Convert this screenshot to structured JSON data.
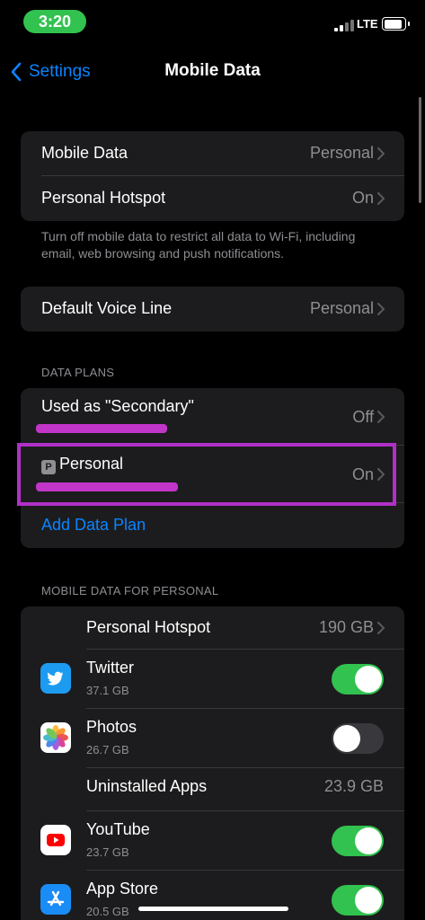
{
  "status_bar": {
    "time": "3:20",
    "network": "LTE"
  },
  "nav": {
    "back_label": "Settings",
    "title": "Mobile Data"
  },
  "main_group": {
    "rows": [
      {
        "label": "Mobile Data",
        "value": "Personal"
      },
      {
        "label": "Personal Hotspot",
        "value": "On"
      }
    ]
  },
  "main_footnote": "Turn off mobile data to restrict all data to Wi-Fi, including email, web browsing and push notifications.",
  "voice_line": {
    "label": "Default Voice Line",
    "value": "Personal"
  },
  "data_plans": {
    "header": "DATA PLANS",
    "secondary": {
      "label": "Used as \"Secondary\"",
      "value": "Off"
    },
    "personal": {
      "badge": "P",
      "label": "Personal",
      "value": "On"
    },
    "add_plan": "Add Data Plan"
  },
  "usage": {
    "header": "MOBILE DATA FOR PERSONAL",
    "hotspot": {
      "label": "Personal Hotspot",
      "value": "190 GB"
    },
    "apps": [
      {
        "name": "Twitter",
        "size": "37.1 GB",
        "enabled": true,
        "icon": "twitter-icon"
      },
      {
        "name": "Photos",
        "size": "26.7 GB",
        "enabled": false,
        "icon": "photos-icon"
      }
    ],
    "uninstalled": {
      "label": "Uninstalled Apps",
      "value": "23.9 GB"
    },
    "apps2": [
      {
        "name": "YouTube",
        "size": "23.7 GB",
        "enabled": true,
        "icon": "youtube-icon"
      },
      {
        "name": "App Store",
        "size": "20.5 GB",
        "enabled": true,
        "icon": "app-store-icon"
      }
    ]
  },
  "colors": {
    "accent": "#0a84ff",
    "toggle_on": "#32c24f",
    "highlight": "#b030c7",
    "redaction": "#c235c9"
  }
}
